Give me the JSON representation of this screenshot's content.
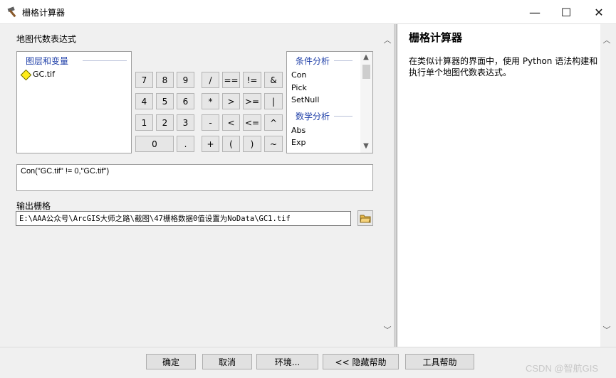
{
  "window": {
    "title": "栅格计算器",
    "minimize_glyph": "—",
    "maximize_glyph": "☐",
    "close_glyph": "✕"
  },
  "main": {
    "expr_label": "地图代数表达式",
    "layers_group": "图层和变量",
    "layers": [
      "GC.tif"
    ],
    "keypad": [
      [
        "7",
        "8",
        "9",
        "/",
        "==",
        "!=",
        "&"
      ],
      [
        "4",
        "5",
        "6",
        "*",
        ">",
        ">=",
        "|"
      ],
      [
        "1",
        "2",
        "3",
        "-",
        "<",
        "<=",
        "^"
      ],
      [
        "0",
        ".",
        "+",
        "(",
        ")",
        "~"
      ]
    ],
    "functions": {
      "group1": "条件分析",
      "group1_items": [
        "Con",
        "Pick",
        "SetNull"
      ],
      "group2": "数学分析",
      "group2_items": [
        "Abs",
        "Exp"
      ]
    },
    "expression": "Con(\"GC.tif\" != 0,\"GC.tif\")",
    "output_label": "输出栅格",
    "output_path": "E:\\AAA公众号\\ArcGIS大师之路\\截图\\47栅格数据0值设置为NoData\\GC1.tif"
  },
  "help": {
    "title": "栅格计算器",
    "body": "在类似计算器的界面中，使用 Python 语法构建和执行单个地图代数表达式。"
  },
  "buttons": {
    "ok": "确定",
    "cancel": "取消",
    "env": "环境...",
    "hide_help": "<< 隐藏帮助",
    "tool_help": "工具帮助"
  },
  "watermark": "CSDN @智航GIS",
  "colors": {
    "group_header": "#1f3fa8",
    "layer_icon": "#ffec1a"
  }
}
